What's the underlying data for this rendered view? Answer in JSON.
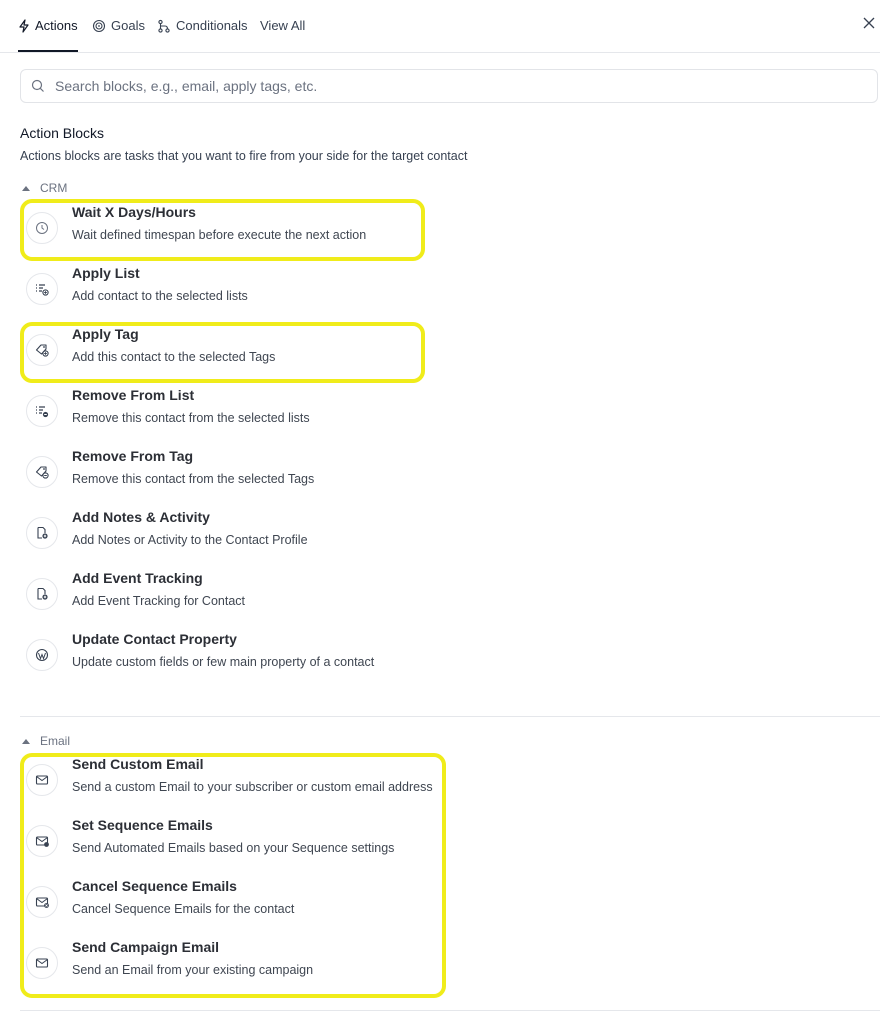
{
  "tabs": [
    {
      "label": "Actions",
      "icon": "bolt-icon",
      "active": true
    },
    {
      "label": "Goals",
      "icon": "target-icon",
      "active": false
    },
    {
      "label": "Conditionals",
      "icon": "branch-icon",
      "active": false
    },
    {
      "label": "View All",
      "icon": "",
      "active": false
    }
  ],
  "search": {
    "placeholder": "Search blocks, e.g., email, apply tags, etc.",
    "value": ""
  },
  "section": {
    "title": "Action Blocks",
    "description": "Actions blocks are tasks that you want to fire from your side for the target contact"
  },
  "groups": {
    "crm": {
      "label": "CRM",
      "items": [
        {
          "title": "Wait X Days/Hours",
          "subtitle": "Wait defined timespan before execute the next action",
          "icon": "clock-icon"
        },
        {
          "title": "Apply List",
          "subtitle": "Add contact to the selected lists",
          "icon": "list-add-icon"
        },
        {
          "title": "Apply Tag",
          "subtitle": "Add this contact to the selected Tags",
          "icon": "tag-add-icon"
        },
        {
          "title": "Remove From List",
          "subtitle": "Remove this contact from the selected lists",
          "icon": "list-remove-icon"
        },
        {
          "title": "Remove From Tag",
          "subtitle": "Remove this contact from the selected Tags",
          "icon": "tag-remove-icon"
        },
        {
          "title": "Add Notes & Activity",
          "subtitle": "Add Notes or Activity to the Contact Profile",
          "icon": "note-add-icon"
        },
        {
          "title": "Add Event Tracking",
          "subtitle": "Add Event Tracking for Contact",
          "icon": "event-add-icon"
        },
        {
          "title": "Update Contact Property",
          "subtitle": "Update custom fields or few main property of a contact",
          "icon": "wordpress-icon"
        }
      ]
    },
    "email": {
      "label": "Email",
      "items": [
        {
          "title": "Send Custom Email",
          "subtitle": "Send a custom Email to your subscriber or custom email address",
          "icon": "email-send-icon"
        },
        {
          "title": "Set Sequence Emails",
          "subtitle": "Send Automated Emails based on your Sequence settings",
          "icon": "email-sequence-icon"
        },
        {
          "title": "Cancel Sequence Emails",
          "subtitle": "Cancel Sequence Emails for the contact",
          "icon": "email-cancel-icon"
        },
        {
          "title": "Send Campaign Email",
          "subtitle": "Send an Email from your existing campaign",
          "icon": "email-campaign-icon"
        }
      ]
    }
  },
  "colors": {
    "highlight": "#f0ec1a",
    "text": "#2c2f36",
    "muted": "#6b7280",
    "border": "#e5e7eb"
  }
}
